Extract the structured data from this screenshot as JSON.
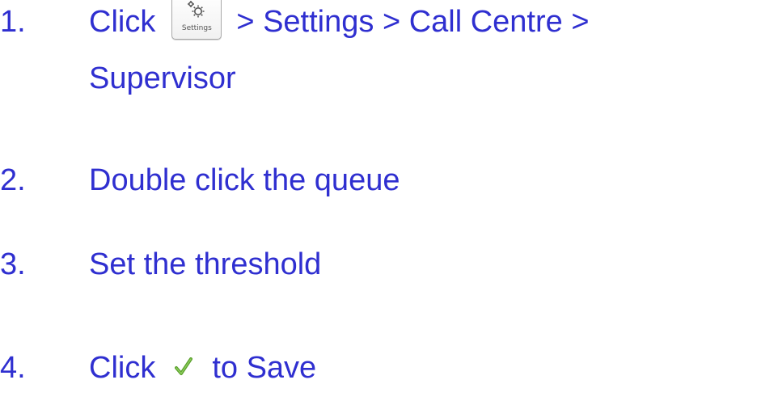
{
  "steps": [
    {
      "number": "1.",
      "click_word": "Click",
      "path_text": "> Settings > Call Centre >",
      "path_text_line2": "Supervisor",
      "button": {
        "icon": "gear-icon",
        "label": "Settings"
      }
    },
    {
      "number": "2.",
      "text": "Double click the queue"
    },
    {
      "number": "3.",
      "text": "Set the threshold"
    },
    {
      "number": "4.",
      "click_word": "Click",
      "after_icon_text": "to Save",
      "icon": "checkmark-icon"
    }
  ],
  "colors": {
    "text": "#2f2fd0",
    "check": "#5aa02c"
  }
}
